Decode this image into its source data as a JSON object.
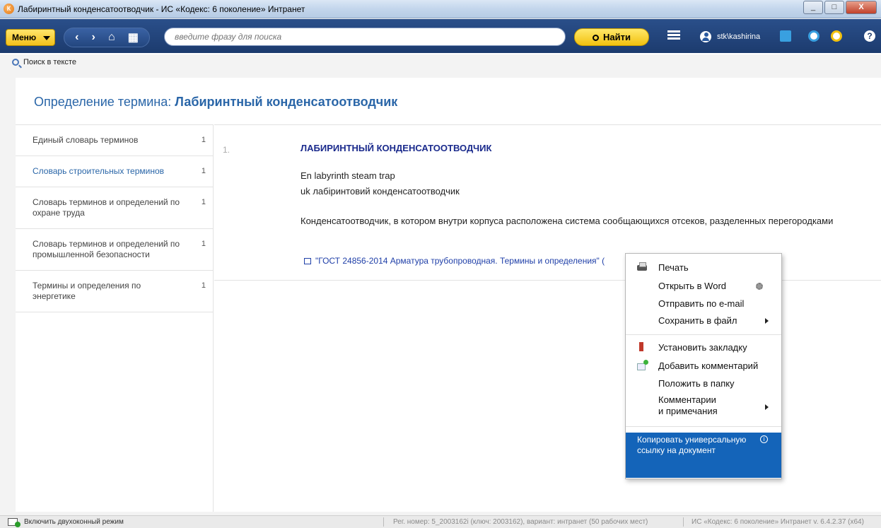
{
  "window": {
    "title": "Лабиринтный конденсатоотводчик - ИС «Кодекс: 6 поколение» Интранет",
    "controls": [
      "_",
      "□",
      "X"
    ]
  },
  "toolbar": {
    "menu_label": "Меню",
    "nav": {
      "back": "‹",
      "forward": "›",
      "home": "⌂",
      "grid": "▦"
    },
    "search_placeholder": "введите фразу для поиска",
    "find_label": "Найти",
    "user_name": "stk\\kashirina",
    "help": "?"
  },
  "search_in_text": "Поиск в тексте",
  "page": {
    "title_prefix": "Определение термина:",
    "title_term": "Лабиринтный конденсатоотводчик"
  },
  "sidebar": {
    "items": [
      {
        "label": "Единый словарь терминов",
        "count": "1",
        "active": false
      },
      {
        "label": "Словарь строительных терминов",
        "count": "1",
        "active": true
      },
      {
        "label": "Словарь терминов и определений по охране труда",
        "count": "1",
        "active": false
      },
      {
        "label": "Словарь терминов и определений по промышленной безопасности",
        "count": "1",
        "active": false
      },
      {
        "label": "Термины и определения по энергетике",
        "count": "1",
        "active": false
      }
    ]
  },
  "content": {
    "number": "1.",
    "term": "ЛАБИРИНТНЫЙ КОНДЕНСАТООТВОДЧИК",
    "en": "En labyrinth steam trap",
    "uk": "uk лабіринтовий конденсатоотводчик",
    "definition": "Конденсатоотводчик, в котором внутри корпуса расположена система сообщающихся отсеков, разделенных перегородками",
    "source_link": "\"ГОСТ 24856-2014 Арматура трубопроводная. Термины и определения\" ("
  },
  "context_menu": {
    "print": "Печать",
    "open_word": "Открыть в Word",
    "send_email": "Отправить по e-mail",
    "save_file": "Сохранить в файл",
    "set_bookmark": "Установить закладку",
    "add_comment": "Добавить комментарий",
    "put_folder": "Положить в папку",
    "comments_notes_1": "Комментарии",
    "comments_notes_2": "и примечания",
    "copy_link": "Копировать универсальную ссылку на документ"
  },
  "status": {
    "dual_mode": "Включить двухоконный режим",
    "registration": "Рег. номер: 5_2003162i (ключ: 2003162), вариант: интранет (50 рабочих мест)",
    "version": "ИС «Кодекс: 6 поколение» Интранет v. 6.4.2.37 (x64)"
  },
  "colors": {
    "accent": "#2a66a8",
    "toolbar": "#1c3b6e",
    "highlight": "#1464b9",
    "button_yellow": "#f2c10f"
  }
}
